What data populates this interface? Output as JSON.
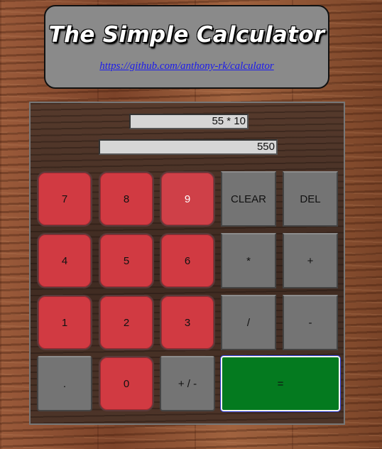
{
  "header": {
    "title": "The Simple Calculator",
    "link": "https://github.com/anthony-rk/calculator"
  },
  "display": {
    "expression": "55 * 10",
    "result": "550"
  },
  "buttons": {
    "seven": "7",
    "eight": "8",
    "nine": "9",
    "clear": "CLEAR",
    "del": "DEL",
    "four": "4",
    "five": "5",
    "six": "6",
    "multiply": "*",
    "plus": "+",
    "one": "1",
    "two": "2",
    "three": "3",
    "divide": "/",
    "minus": "-",
    "dot": ".",
    "zero": "0",
    "sign": "+ / -",
    "equals": "="
  },
  "colors": {
    "digit": "#d13a42",
    "operator": "#747474",
    "equals": "#047a1f",
    "header": "#8a8a8a"
  }
}
